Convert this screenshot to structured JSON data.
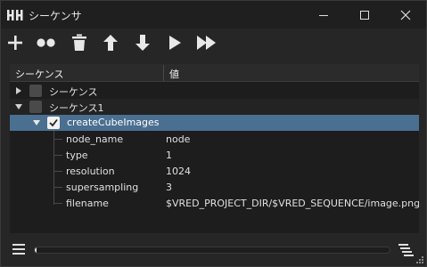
{
  "window": {
    "title": "シーケンサ"
  },
  "toolbar": {
    "buttons": [
      {
        "name": "add-icon"
      },
      {
        "name": "group-icon"
      },
      {
        "name": "delete-icon"
      },
      {
        "name": "move-up-icon"
      },
      {
        "name": "move-down-icon"
      },
      {
        "name": "run-icon"
      },
      {
        "name": "run-all-icon"
      }
    ]
  },
  "tree": {
    "columns": [
      "シーケンス",
      "値"
    ],
    "rows": [
      {
        "label": "シーケンス",
        "expanded": false,
        "checked": false
      },
      {
        "label": "シーケンス1",
        "expanded": true,
        "checked": false
      },
      {
        "label": "createCubeImages",
        "expanded": true,
        "checked": true,
        "selected": true
      }
    ],
    "properties": [
      {
        "name": "node_name",
        "value": "node"
      },
      {
        "name": "type",
        "value": "1"
      },
      {
        "name": "resolution",
        "value": "1024"
      },
      {
        "name": "supersampling",
        "value": "3"
      },
      {
        "name": "filename",
        "value": "$VRED_PROJECT_DIR/$VRED_SEQUENCE/image.png"
      }
    ]
  },
  "progress": {
    "fraction": 0.0
  },
  "colors": {
    "selection": "#4a6f90",
    "background": "#262626",
    "panel": "#1d1d1d"
  }
}
